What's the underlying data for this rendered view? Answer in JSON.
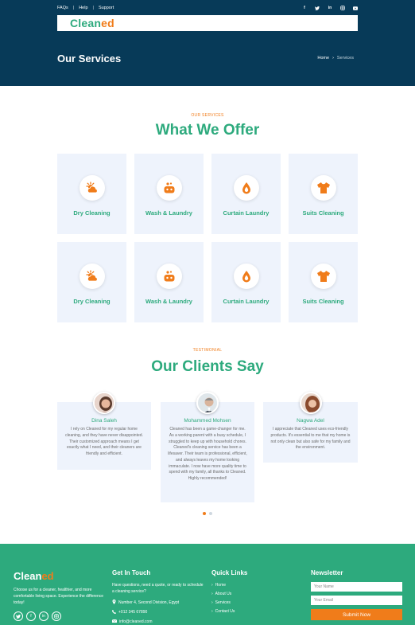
{
  "topbar": {
    "links": [
      "FAQs",
      "Help",
      "Support"
    ],
    "separator": "|",
    "socials": [
      "facebook-icon",
      "twitter-icon",
      "linkedin-icon",
      "instagram-icon",
      "youtube-icon"
    ]
  },
  "brand": {
    "name_main": "Clean",
    "name_accent": "ed",
    "main_color": "#2daa7d",
    "accent_color": "#f07c1a"
  },
  "banner": {
    "title": "Our Services",
    "breadcrumb_home": "Home",
    "breadcrumb_sep": "›",
    "breadcrumb_current": "Services",
    "background": "#073a58"
  },
  "services": {
    "eyebrow": "OUR SERVICES",
    "title": "What We Offer",
    "rows": [
      [
        {
          "label": "Dry Cleaning",
          "icon": "sun-cloud-icon"
        },
        {
          "label": "Wash & Laundry",
          "icon": "soap-bubbles-icon"
        },
        {
          "label": "Curtain Laundry",
          "icon": "water-drop-icon"
        },
        {
          "label": "Suits Cleaning",
          "icon": "tshirt-icon"
        }
      ],
      [
        {
          "label": "Dry Cleaning",
          "icon": "sun-cloud-icon"
        },
        {
          "label": "Wash & Laundry",
          "icon": "soap-bubbles-icon"
        },
        {
          "label": "Curtain Laundry",
          "icon": "water-drop-icon"
        },
        {
          "label": "Suits Cleaning",
          "icon": "tshirt-icon"
        }
      ]
    ]
  },
  "testimonials": {
    "eyebrow": "TESTIMONIAL",
    "title": "Our Clients Say",
    "items": [
      {
        "name": "Dina Saleh",
        "text": "I rely on Cleaned for my regular home cleaning, and they have never disappointed. Their customized approach means I get exactly what I need, and their cleaners are friendly and efficient."
      },
      {
        "name": "Mohammed Mohsen",
        "text": "Cleaned has been a game-changer for me. As a working parent with a busy schedule, I struggled to keep up with household chores. Cleaned's cleaning service has been a lifesaver. Their team is professional, efficient, and always leaves my home looking immaculate. I now have more quality time to spend with my family, all thanks to Cleaned. Highly recommended!"
      },
      {
        "name": "Nagwa Adel",
        "text": "I appreciate that Cleaned uses eco-friendly products. It's essential to me that my home is not only clean but also safe for my family and the environment."
      }
    ],
    "pager": {
      "total": 2,
      "active": 1
    }
  },
  "footer": {
    "about": "Choose us for a cleaner, healthier, and more comfortable living space. Experience the difference today!",
    "socials": [
      "twitter-icon",
      "facebook-icon",
      "linkedin-icon",
      "instagram-icon"
    ],
    "contact": {
      "heading": "Get In Touch",
      "text": "Have questions, need a quote, or ready to schedule a cleaning service?",
      "address": "Number 4, Second Division, Egypt",
      "phone": "+012 345 67890",
      "email": "info@cleaned.com"
    },
    "quick_links": {
      "heading": "Quick Links",
      "items": [
        "Home",
        "About Us",
        "Services",
        "Contact Us"
      ]
    },
    "newsletter": {
      "heading": "Newsletter",
      "name_placeholder": "Your Name",
      "email_placeholder": "Your Email",
      "submit": "Submit Now"
    },
    "background": "#2daa7d"
  }
}
